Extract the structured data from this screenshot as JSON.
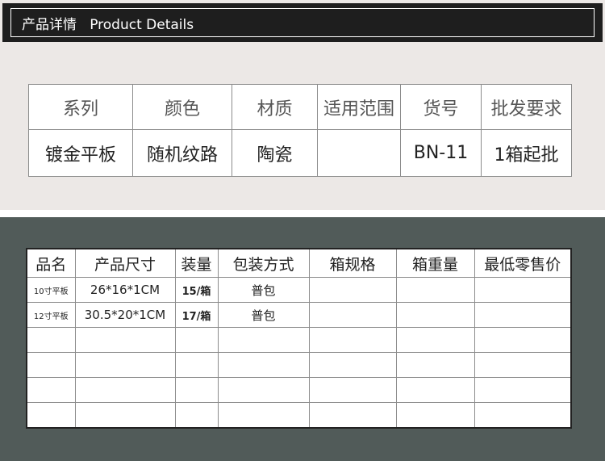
{
  "header": {
    "title": "产品详情   Product Details"
  },
  "spec_table": {
    "headers": [
      "系列",
      "颜色",
      "材质",
      "适用范围",
      "货号",
      "批发要求"
    ],
    "values": [
      "镀金平板",
      "随机纹路",
      "陶瓷",
      "",
      "BN-11",
      "1箱起批"
    ]
  },
  "size_table": {
    "headers": [
      "品名",
      "产品尺寸",
      "装量",
      "包装方式",
      "箱规格",
      "箱重量",
      "最低零售价"
    ],
    "rows": [
      [
        "10寸平板",
        "26*16*1CM",
        "15/箱",
        "普包",
        "",
        "",
        ""
      ],
      [
        "12寸平板",
        "30.5*20*1CM",
        "17/箱",
        "普包",
        "",
        "",
        ""
      ],
      [
        "",
        "",
        "",
        "",
        "",
        "",
        ""
      ],
      [
        "",
        "",
        "",
        "",
        "",
        "",
        ""
      ],
      [
        "",
        "",
        "",
        "",
        "",
        "",
        ""
      ],
      [
        "",
        "",
        "",
        "",
        "",
        "",
        ""
      ]
    ]
  }
}
